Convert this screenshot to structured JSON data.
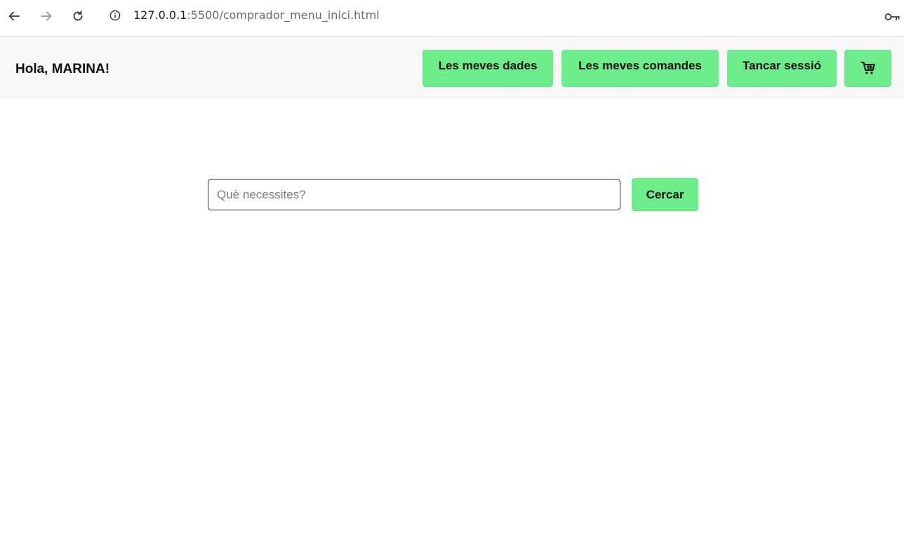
{
  "browser": {
    "url_host": "127.0.0.1",
    "url_rest": ":5500/comprador_menu_inici.html"
  },
  "header": {
    "greeting": "Hola, MARINA!",
    "buttons": {
      "dades": "Les meves dades",
      "comandes": "Les meves comandes",
      "sessio": "Tancar sessió"
    },
    "accent_color": "#6dec8b"
  },
  "search": {
    "placeholder": "Què necessites?",
    "value": "",
    "button_label": "Cercar"
  },
  "icons": {
    "back": "back-arrow-icon",
    "forward": "forward-arrow-icon",
    "reload": "reload-icon",
    "info": "info-icon",
    "key": "key-icon",
    "cart": "shopping-cart-icon"
  }
}
